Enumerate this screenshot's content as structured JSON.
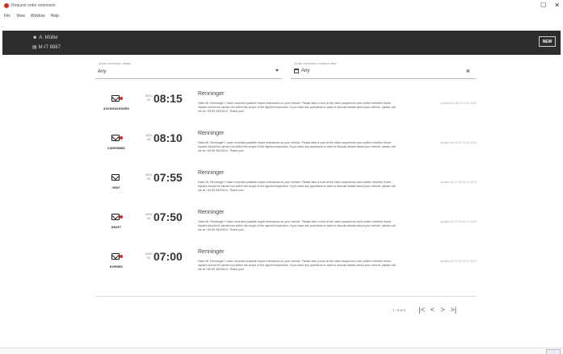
{
  "window": {
    "title": "Request order extension",
    "controls": [
      "☐",
      "✕"
    ]
  },
  "menu": [
    "File",
    "View",
    "Window",
    "Help"
  ],
  "header": {
    "owner": "A. Müller",
    "plate": "M-IT 8887",
    "new_label": "NEW"
  },
  "filters": {
    "status_label": "Order extension status",
    "status_value": "Any",
    "date_label": "Order extension creation date",
    "date_value": "Any"
  },
  "entries": [
    {
      "status": "ACKNOWLEDGED",
      "month": "NOV",
      "day": "02",
      "time": "08:15",
      "title": "Renninger",
      "text": "Hello Mr. Renninger! I have recorded possible repair extensions on your vehicle. Please take a look at the video sequences and confirm whether these repairs should be carried out within the scope of the agreed inspection. If you have any questions or want to discuss details about your vehicle, please call me at +49 89 452200-0. Thank you!",
      "updated": "updated @ 08:15 02.11.2020"
    },
    {
      "status": "CONFIRMED",
      "month": "NOV",
      "day": "02",
      "time": "08:10",
      "title": "Renninger",
      "text": "Hello Mr. Renninger! I have recorded possible repair extensions on your vehicle. Please take a look at the video sequences and confirm whether these repairs should be carried out within the scope of the agreed inspection. If you have any questions or want to discuss details about your vehicle, please call me at +49 89 452200-0. Thank you!",
      "updated": "updated @ 08:10 02.11.2020"
    },
    {
      "status": "SENT",
      "month": "NOV",
      "day": "02",
      "time": "07:55",
      "title": "Renninger",
      "text": "Hello Mr. Renninger! I have recorded possible repair extensions on your vehicle. Please take a look at the video sequences and confirm whether these repairs should be carried out within the scope of the agreed inspection. If you have any questions or want to discuss details about your vehicle, please call me at +49 89 452200-0. Thank you!",
      "updated": "updated @ 07:55 02.11.2020"
    },
    {
      "status": "DRAFT",
      "month": "NOV",
      "day": "02",
      "time": "07:50",
      "title": "Renninger",
      "text": "Hello Mr. Renninger! I have recorded possible repair extensions on your vehicle. Please take a look at the video sequences and confirm whether these repairs should be carried out within the scope of the agreed inspection. If you have any questions or want to discuss details about your vehicle, please call me at +49 89 452200-0. Thank you!",
      "updated": "updated @ 07:50 02.11.2020"
    },
    {
      "status": "EXPIRED",
      "month": "NOV",
      "day": "02",
      "time": "07:00",
      "title": "Renninger",
      "text": "Hello Mr. Renninger! I have recorded possible repair extensions on your vehicle. Please take a look at the video sequences and confirm whether these repairs should be carried out within the scope of the agreed inspection. If you have any questions or want to discuss details about your vehicle, please call me at +49 89 452200-0. Thank you!",
      "updated": "updated @ 07:00 02.11.2020"
    }
  ],
  "pagination": {
    "range": "1 - 5 of 5",
    "first": "|<",
    "prev": "<",
    "next": ">",
    "last": ">|"
  },
  "icons": {
    "status": "envelope-icon",
    "owner": "person-icon",
    "plate": "car-icon",
    "date_filter": "calendar-icon"
  },
  "colors": {
    "header_bg": "#2d2d2d",
    "accent": "#d9281c"
  }
}
